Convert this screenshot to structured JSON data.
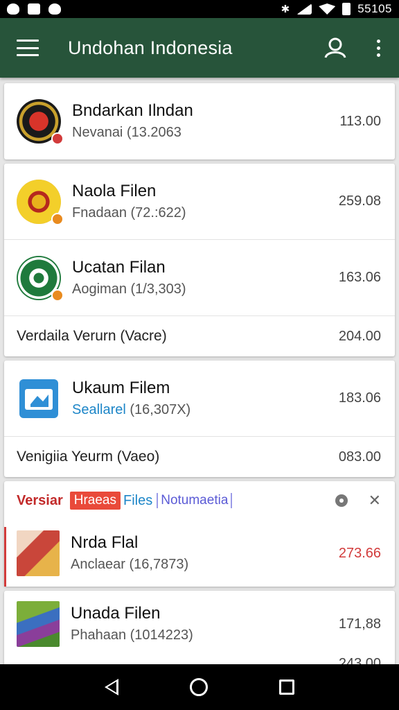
{
  "status_bar": {
    "time": "55105",
    "icons": [
      "lock-icon",
      "message-icon",
      "shield-icon",
      "bluetooth-icon",
      "signal-icon",
      "wifi-icon",
      "battery-icon"
    ]
  },
  "app_bar": {
    "title": "Undohan Indonesia",
    "background": "#27543a",
    "icons": [
      "menu-icon",
      "account-icon",
      "more-vert-icon"
    ]
  },
  "cards": [
    {
      "items": [
        {
          "title": "Bndarkan Ilndan",
          "subtitle": "Nevanai (13.2063",
          "amount": "113.00",
          "avatar": "emblem-red",
          "badge_color": "#d23b3b"
        }
      ]
    },
    {
      "items": [
        {
          "title": "Naola Filen",
          "subtitle": "Fnadaan (72.:622)",
          "amount": "259.08",
          "avatar": "emblem-yellow",
          "badge_color": "#e98b1f"
        },
        {
          "title": "Ucatan Filan",
          "subtitle": "Aogiman (1/3,303)",
          "amount": "163.06",
          "avatar": "emblem-green",
          "badge_color": "#e98b1f"
        }
      ],
      "sub_row": {
        "label": "Verdaila Verurn (Vacre)",
        "amount": "204.00"
      }
    },
    {
      "items": [
        {
          "title": "Ukaum Filem",
          "subtitle": "Seallarel",
          "subtitle_rest": " (16,307X)",
          "amount": "183.06",
          "avatar": "file-blue"
        }
      ],
      "sub_row": {
        "label": "Venigiia Yeurm (Vaeo)",
        "amount": "083.00"
      }
    }
  ],
  "filter_bar": {
    "version_label": "Versiar",
    "tag": "Hraeas",
    "files": "Files",
    "docs": "Notumaetia"
  },
  "bottom_items": [
    {
      "title": "Nrda Flal",
      "subtitle": "Anclaear (16,7873)",
      "amount": "273.66",
      "amount_color": "#d23b3b"
    },
    {
      "title": "Unada Filen",
      "subtitle": "Phahaan (1014223)",
      "amount": "171,88"
    }
  ],
  "partial_amount": "243.00",
  "colors": {
    "accent_green": "#27543a",
    "accent_red": "#d23b3b",
    "link_blue": "#1d86c8"
  }
}
